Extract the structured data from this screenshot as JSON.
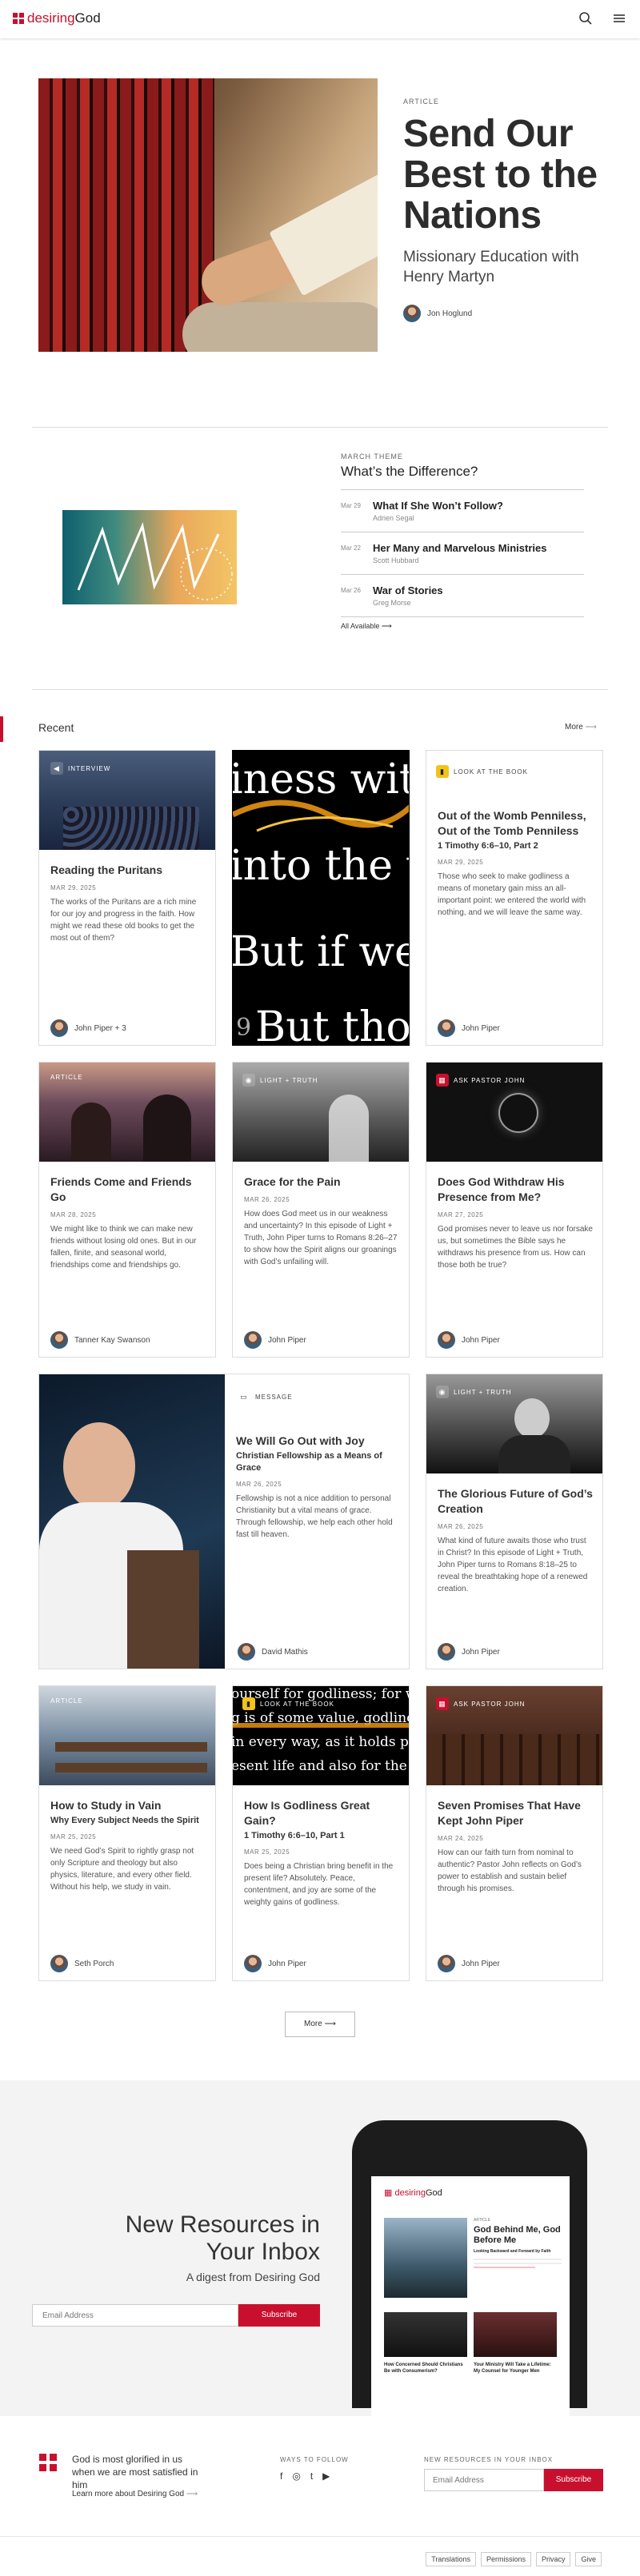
{
  "header": {
    "brand_a": "desiring",
    "brand_b": "God",
    "search_icon": "search-icon",
    "menu_icon": "menu-icon",
    "accent": "#c8102e"
  },
  "hero": {
    "eyebrow": "ARTICLE",
    "title": "Send Our Best to the Nations",
    "subtitle": "Missionary Education with Henry Martyn",
    "author": "Jon Hoglund"
  },
  "theme": {
    "eyebrow": "MARCH THEME",
    "title": "What’s the Difference?",
    "items": [
      {
        "date": "Mar 29",
        "title": "What If She Won’t Follow?",
        "author": "Adrien Segal"
      },
      {
        "date": "Mar 22",
        "title": "Her Many and Marvelous Ministries",
        "author": "Scott Hubbard"
      },
      {
        "date": "Mar 26",
        "title": "War of Stories",
        "author": "Greg Morse"
      }
    ],
    "all_label": "All Available"
  },
  "recent": {
    "title": "Recent",
    "more": "More"
  },
  "cards": [
    {
      "badge": "INTERVIEW",
      "title": "Reading the Puritans",
      "date": "MAR 29, 2025",
      "excerpt": "The works of the Puritans are a rich mine for our joy and progress in the faith. How might we read these old books to get the most out of them?",
      "author": "John Piper + 3"
    },
    {
      "type_text": [
        "iness wit",
        "into the w",
        "But if we",
        "But tho"
      ],
      "number": "9"
    },
    {
      "badge": "LOOK AT THE BOOK",
      "title": "Out of the Womb Penniless, Out of the Tomb Penniless",
      "subtitle": "1 Timothy 6:6–10, Part 2",
      "date": "MAR 29, 2025",
      "excerpt": "Those who seek to make godliness a means of monetary gain miss an all-important point: we entered the world with nothing, and we will leave the same way.",
      "author": "John Piper"
    },
    {
      "badge": "ARTICLE",
      "title": "Friends Come and Friends Go",
      "date": "MAR 28, 2025",
      "excerpt": "We might like to think we can make new friends without losing old ones. But in our fallen, finite, and seasonal world, friendships come and friendships go.",
      "author": "Tanner Kay Swanson"
    },
    {
      "badge": "LIGHT + TRUTH",
      "title": "Grace for the Pain",
      "date": "MAR 26, 2025",
      "excerpt": "How does God meet us in our weakness and uncertainty? In this episode of Light + Truth, John Piper turns to Romans 8:26–27 to show how the Spirit aligns our groanings with God’s unfailing will.",
      "author": "John Piper"
    },
    {
      "badge": "ASK PASTOR JOHN",
      "title": "Does God Withdraw His Presence from Me?",
      "date": "MAR 27, 2025",
      "excerpt": "God promises never to leave us nor forsake us, but sometimes the Bible says he withdraws his presence from us. How can those both be true?",
      "author": "John Piper"
    },
    {
      "badge": "MESSAGE",
      "title": "We Will Go Out with Joy",
      "subtitle": "Christian Fellowship as a Means of Grace",
      "date": "MAR 26, 2025",
      "excerpt": "Fellowship is not a nice addition to personal Christianity but a vital means of grace. Through fellowship, we help each other hold fast till heaven.",
      "author": "David Mathis"
    },
    {
      "badge": "LIGHT + TRUTH",
      "title": "The Glorious Future of God’s Creation",
      "date": "MAR 26, 2025",
      "excerpt": "What kind of future awaits those who trust in Christ? In this episode of Light + Truth, John Piper turns to Romans 8:18–25 to reveal the breathtaking hope of a renewed creation.",
      "author": "John Piper"
    },
    {
      "badge": "ARTICLE",
      "title": "How to Study in Vain",
      "subtitle": "Why Every Subject Needs the Spirit",
      "date": "MAR 25, 2025",
      "excerpt": "We need God’s Spirit to rightly grasp not only Scripture and theology but also physics, literature, and every other field. Without his help, we study in vain.",
      "author": "Seth Porch"
    },
    {
      "badge": "LOOK AT THE BOOK",
      "title": "How Is Godliness Great Gain?",
      "subtitle": "1 Timothy 6:6–10, Part 1",
      "date": "MAR 25, 2025",
      "excerpt": "Does being a Christian bring benefit in the present life? Absolutely. Peace, contentment, and joy are some of the weighty gains of godliness.",
      "author": "John Piper",
      "type_text": [
        "ourself for godliness; for whi",
        "g is of some value, godliness i",
        "in every way, as it holds promi",
        "esent life and also for the life t"
      ]
    },
    {
      "badge": "ASK PASTOR JOHN",
      "title": "Seven Promises That Have Kept John Piper",
      "date": "MAR 24, 2025",
      "excerpt": "How can our faith turn from nominal to authentic? Pastor John reflects on God’s power to establish and sustain belief through his promises.",
      "author": "John Piper"
    }
  ],
  "more_button": "More",
  "newsletter": {
    "title": "New Resources in Your Inbox",
    "subtitle": "A digest from Desiring God",
    "placeholder": "Email Address",
    "button": "Subscribe",
    "phone": {
      "brand_a": "desiring",
      "brand_b": "God",
      "kicker": "ARTICLE",
      "headline": "God Behind Me, God Before Me",
      "subhead": "Looking Backward and Forward by Faith",
      "item1_title": "How Concerned Should Christians Be with Consumerism?",
      "item2_title": "Your Ministry Will Take a Lifetime: My Counsel for Younger Men"
    }
  },
  "footer": {
    "tagline": "God is most glorified in us when we are most satisfied in him",
    "learn": "Learn more about Desiring God",
    "follow": "WAYS TO FOLLOW",
    "social": [
      "f",
      "◎",
      "t",
      "▶"
    ],
    "news_label": "NEW RESOURCES IN YOUR INBOX",
    "placeholder": "Email Address",
    "button": "Subscribe",
    "links": [
      "Translations",
      "Permissions",
      "Privacy",
      "Give"
    ]
  }
}
